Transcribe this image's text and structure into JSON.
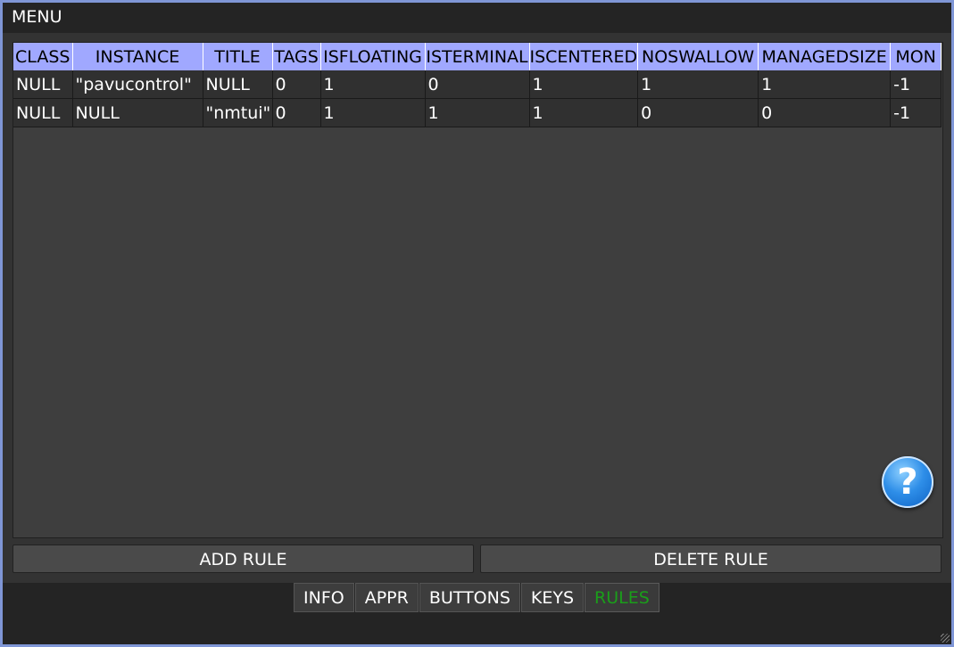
{
  "window": {
    "title": "MENU"
  },
  "table": {
    "headers": [
      "CLASS",
      "INSTANCE",
      "TITLE",
      "TAGS",
      "ISFLOATING",
      "ISTERMINAL",
      "ISCENTERED",
      "NOSWALLOW",
      "MANAGEDSIZE",
      "MON"
    ],
    "rows": [
      [
        "NULL",
        "\"pavucontrol\"",
        "NULL",
        "0",
        "1",
        "0",
        "1",
        "1",
        "1",
        "-1"
      ],
      [
        "NULL",
        "NULL",
        "\"nmtui\"",
        "0",
        "1",
        "1",
        "1",
        "0",
        "0",
        "-1"
      ]
    ]
  },
  "buttons": {
    "add": "ADD RULE",
    "delete": "DELETE RULE"
  },
  "help": {
    "glyph": "?",
    "icon": "help-icon"
  },
  "tabs": [
    {
      "label": "INFO",
      "active": false
    },
    {
      "label": "APPR",
      "active": false
    },
    {
      "label": "BUTTONS",
      "active": false
    },
    {
      "label": "KEYS",
      "active": false
    },
    {
      "label": "RULES",
      "active": true
    }
  ],
  "colors": {
    "header_bg": "#a0a8ff",
    "active_tab": "#1a9e1a",
    "border": "#7f96d6"
  }
}
